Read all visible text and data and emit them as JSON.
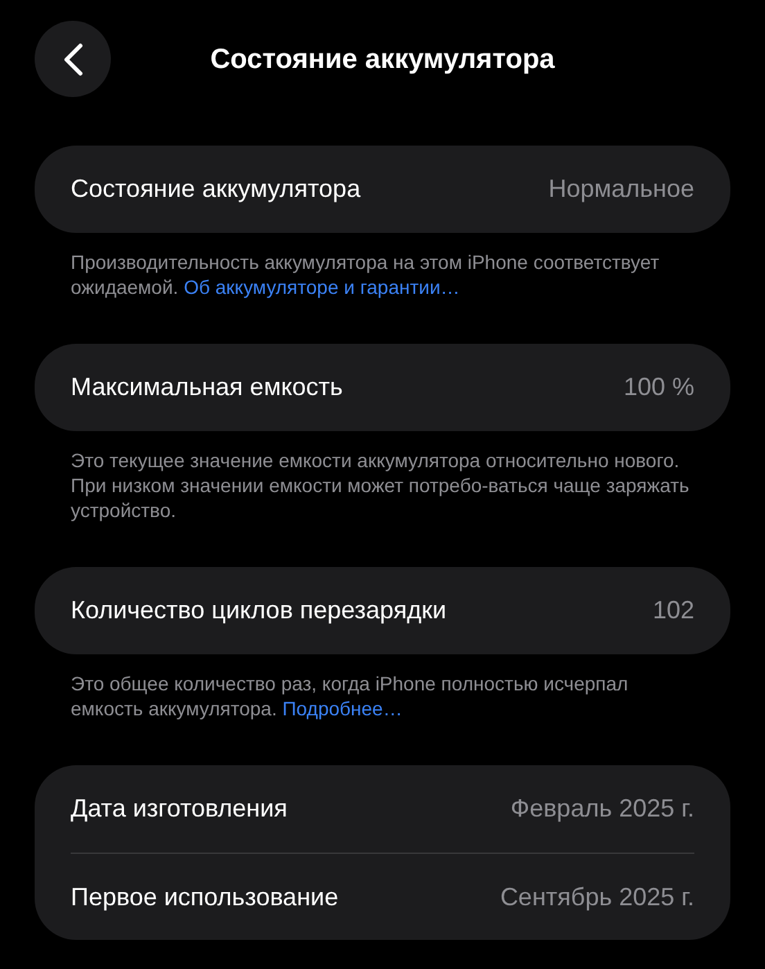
{
  "header": {
    "title": "Состояние аккумулятора"
  },
  "sections": [
    {
      "rows": [
        {
          "label": "Состояние аккумулятора",
          "value": "Нормальное"
        }
      ],
      "footnote": {
        "text": "Производительность аккумулятора на этом iPhone соответствует ожидаемой.",
        "link": "Об аккумуляторе и гарантии…"
      }
    },
    {
      "rows": [
        {
          "label": "Максимальная емкость",
          "value": "100 %"
        }
      ],
      "footnote": {
        "text": "Это текущее значение емкости аккумулятора относительно нового. При низком значении емкости может потребо-ваться чаще заряжать устройство."
      }
    },
    {
      "rows": [
        {
          "label": "Количество циклов перезарядки",
          "value": "102"
        }
      ],
      "footnote": {
        "text": "Это общее количество раз, когда iPhone полностью исчерпал емкость аккумулятора.",
        "link": "Подробнее…"
      }
    },
    {
      "rows": [
        {
          "label": "Дата изготовления",
          "value": "Февраль 2025 г."
        },
        {
          "label": "Первое использование",
          "value": "Сентябрь 2025 г."
        }
      ]
    }
  ]
}
